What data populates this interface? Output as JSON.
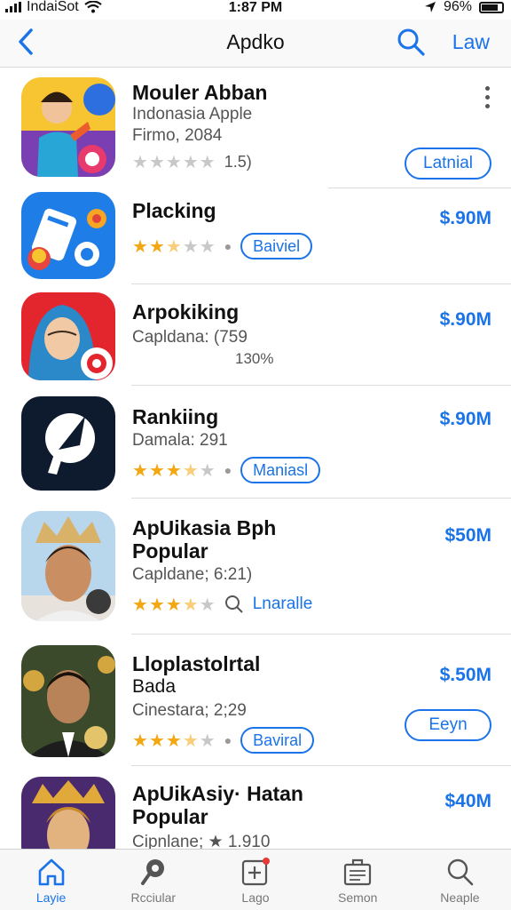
{
  "status_bar": {
    "carrier": "IndaiSot",
    "time": "1:87 PM",
    "battery": "96%"
  },
  "nav": {
    "title": "Apdko",
    "right_label": "Law"
  },
  "apps": [
    {
      "name": "Mouler Abban",
      "line1": "Indonasia Apple",
      "line2": "Firmo, 2084",
      "rating_value": "1.5)",
      "stars": 0,
      "button": "Latnial"
    },
    {
      "name": "Placking",
      "price": "$.90M",
      "stars": 2.5,
      "chip": "Baiviel"
    },
    {
      "name": "Arpokiking",
      "line1": "Capldana: (759",
      "line2": "130%",
      "price": "$.90M"
    },
    {
      "name": "Rankiing",
      "line1": "Damala: 291",
      "price": "$.90M",
      "stars": 3.5,
      "chip": "Maniasl"
    },
    {
      "name": "ApUikasia  Bph",
      "name2": "Popular",
      "line1": "Capldane; 6:21)",
      "price": "$50M",
      "stars": 3.5,
      "chip": "Lnaralle"
    },
    {
      "name": "Lloplastolrtal",
      "name2": "Bada",
      "line1": "Cinestara; 2;29",
      "price": "$.50M",
      "stars": 3.5,
      "chip": "Baviral",
      "button": "Eeyn"
    },
    {
      "name": "ApUikAsiy· Hatan",
      "name2": "Popular",
      "line1": "Cipnlane; ★ 1.910",
      "price": "$40M"
    }
  ],
  "tabs": [
    {
      "label": "Layie",
      "icon": "home-icon",
      "active": true
    },
    {
      "label": "Rcciular",
      "icon": "pin-icon",
      "active": false
    },
    {
      "label": "Lago",
      "icon": "add-box-icon",
      "active": false
    },
    {
      "label": "Semon",
      "icon": "briefcase-icon",
      "active": false
    },
    {
      "label": "Neaple",
      "icon": "search-icon",
      "active": false
    }
  ],
  "colors": {
    "accent": "#1a73e8",
    "star": "#f3a712"
  }
}
